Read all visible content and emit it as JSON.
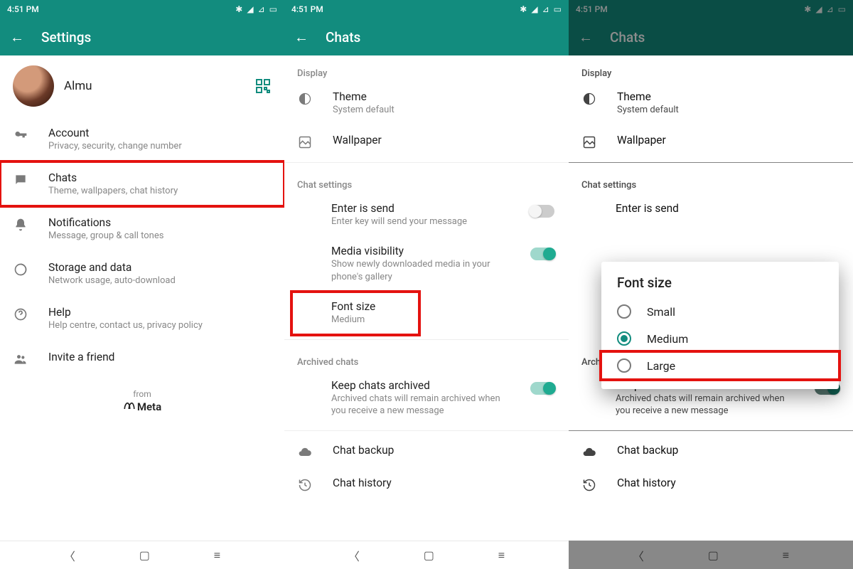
{
  "status": {
    "time": "4:51 PM"
  },
  "screen1": {
    "title": "Settings",
    "profile_name": "Almu",
    "items": [
      {
        "label": "Account",
        "sub": "Privacy, security, change number"
      },
      {
        "label": "Chats",
        "sub": "Theme, wallpapers, chat history"
      },
      {
        "label": "Notifications",
        "sub": "Message, group & call tones"
      },
      {
        "label": "Storage and data",
        "sub": "Network usage, auto-download"
      },
      {
        "label": "Help",
        "sub": "Help centre, contact us, privacy policy"
      },
      {
        "label": "Invite a friend",
        "sub": ""
      }
    ],
    "from": "from",
    "meta": "Meta"
  },
  "screen2": {
    "title": "Chats",
    "display_header": "Display",
    "theme": {
      "label": "Theme",
      "sub": "System default"
    },
    "wallpaper": {
      "label": "Wallpaper"
    },
    "chat_settings_header": "Chat settings",
    "enter_is_send": {
      "label": "Enter is send",
      "sub": "Enter key will send your message",
      "on": false
    },
    "media_visibility": {
      "label": "Media visibility",
      "sub": "Show newly downloaded media in your phone's gallery",
      "on": true
    },
    "font_size": {
      "label": "Font size",
      "sub": "Medium"
    },
    "archived_header": "Archived chats",
    "keep_archived": {
      "label": "Keep chats archived",
      "sub": "Archived chats will remain archived when you receive a new message",
      "on": true
    },
    "chat_backup": {
      "label": "Chat backup"
    },
    "chat_history": {
      "label": "Chat history"
    }
  },
  "dialog": {
    "title": "Font size",
    "options": [
      {
        "label": "Small",
        "selected": false
      },
      {
        "label": "Medium",
        "selected": true
      },
      {
        "label": "Large",
        "selected": false
      }
    ]
  }
}
